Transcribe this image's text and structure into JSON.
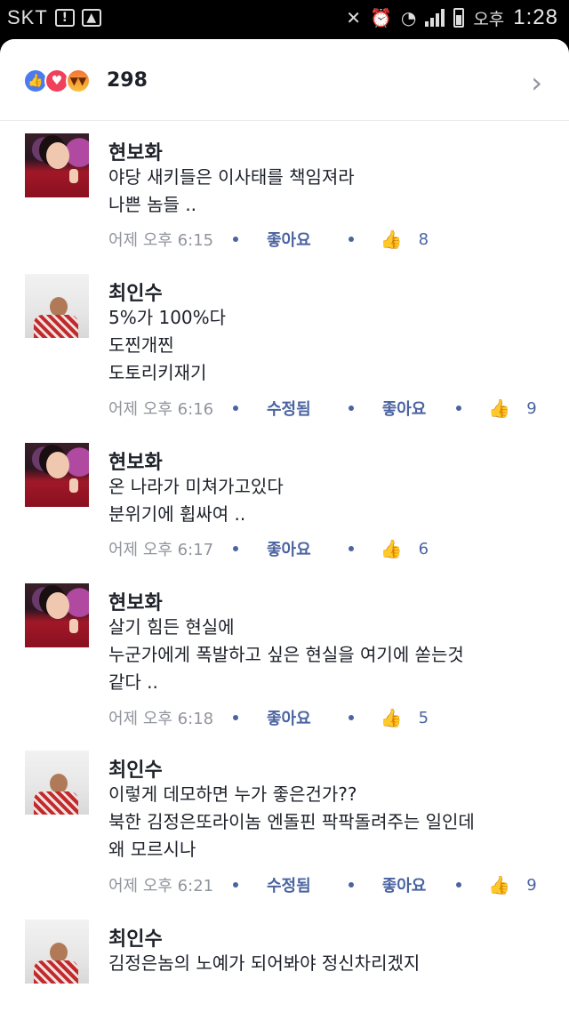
{
  "status_bar": {
    "carrier": "SKT",
    "ampm": "오후",
    "time": "1:28"
  },
  "reactions": {
    "count": "298"
  },
  "comments": [
    {
      "name": "현보화",
      "lines": [
        "야당 새키들은 이사태를 책임져라",
        "나쁜 놈들 .."
      ],
      "time": "어제 오후 6:15",
      "edited": "",
      "like_label": "좋아요",
      "likes": "8"
    },
    {
      "name": "최인수",
      "lines": [
        "5%가 100%다",
        "도찐개찐",
        "도토리키재기"
      ],
      "time": "어제 오후 6:16",
      "edited": "수정됨",
      "like_label": "좋아요",
      "likes": "9"
    },
    {
      "name": "현보화",
      "lines": [
        "온 나라가 미쳐가고있다",
        "분위기에 휩싸여 .."
      ],
      "time": "어제 오후 6:17",
      "edited": "",
      "like_label": "좋아요",
      "likes": "6"
    },
    {
      "name": "현보화",
      "lines": [
        "살기 힘든 현실에",
        "누군가에게 폭발하고 싶은 현실을 여기에 쏟는것",
        "같다 .."
      ],
      "time": "어제 오후 6:18",
      "edited": "",
      "like_label": "좋아요",
      "likes": "5"
    },
    {
      "name": "최인수",
      "lines": [
        "이렇게 데모하면 누가 좋은건가??",
        "북한 김정은또라이놈 엔돌핀 팍팍돌려주는 일인데",
        "왜 모르시나"
      ],
      "time": "어제 오후 6:21",
      "edited": "수정됨",
      "like_label": "좋아요",
      "likes": "9"
    },
    {
      "name": "최인수",
      "lines": [
        "김정은놈의 노예가 되어봐야 정신차리겠지"
      ],
      "time": "",
      "edited": "",
      "like_label": "",
      "likes": ""
    }
  ]
}
